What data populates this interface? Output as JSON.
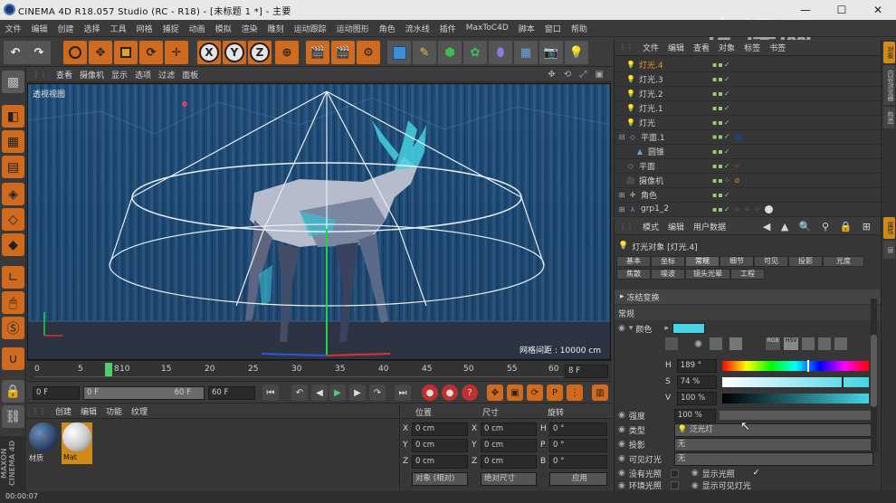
{
  "window": {
    "title": "CINEMA 4D R18.057 Studio (RC - R18) - [未标题 1 *] - 主要",
    "minimize": "—",
    "maximize": "☐",
    "close": "✕"
  },
  "watermark": "虎课网",
  "menu": [
    "文件",
    "编辑",
    "创建",
    "选择",
    "工具",
    "网格",
    "捕捉",
    "动画",
    "模拟",
    "渲染",
    "雕刻",
    "运动跟踪",
    "运动图形",
    "角色",
    "流水线",
    "插件",
    "MaxToC4D",
    "脚本",
    "窗口",
    "帮助"
  ],
  "toolbar": {
    "x": "X",
    "y": "Y",
    "z": "Z"
  },
  "viewport": {
    "menu": [
      "查看",
      "摄像机",
      "显示",
      "选项",
      "过滤",
      "面板"
    ],
    "label": "透视视图",
    "grid_text": "网格间距 : 10000 cm"
  },
  "timeline": {
    "ticks": [
      "0",
      "5",
      "10",
      "15",
      "20",
      "25",
      "30",
      "35",
      "40",
      "45",
      "50",
      "55",
      "60"
    ],
    "current_frame_marker": "8",
    "end_field": "8 F"
  },
  "transport": {
    "start": "0 F",
    "range_start": "0 F",
    "range_end": "60 F",
    "end": "60 F"
  },
  "materials": {
    "menu": [
      "创建",
      "编辑",
      "功能",
      "纹理"
    ],
    "items": [
      "材质",
      "Mat"
    ]
  },
  "coords": {
    "headers": {
      "position": "位置",
      "size": "尺寸",
      "rotation": "旋转"
    },
    "rows": [
      {
        "p_label": "X",
        "p": "0 cm",
        "s_label": "X",
        "s": "0 cm",
        "r_label": "H",
        "r": "0 °"
      },
      {
        "p_label": "Y",
        "p": "0 cm",
        "s_label": "Y",
        "s": "0 cm",
        "r_label": "P",
        "r": "0 °"
      },
      {
        "p_label": "Z",
        "p": "0 cm",
        "s_label": "Z",
        "s": "0 cm",
        "r_label": "B",
        "r": "0 °"
      }
    ],
    "mode": "对象 (相对)",
    "size_mode": "绝对尺寸",
    "apply": "应用"
  },
  "objects": {
    "menu": [
      "文件",
      "编辑",
      "查看",
      "对象",
      "标签",
      "书签"
    ],
    "items": [
      {
        "name": "灯光.4",
        "icon": "light-icon",
        "active": true
      },
      {
        "name": "灯光.3",
        "icon": "light-icon"
      },
      {
        "name": "灯光.2",
        "icon": "light-icon"
      },
      {
        "name": "灯光.1",
        "icon": "light-icon"
      },
      {
        "name": "灯光",
        "icon": "light-icon"
      },
      {
        "name": "平面.1",
        "icon": "plane-icon"
      },
      {
        "name": "圆锥",
        "icon": "cone-icon"
      },
      {
        "name": "平面",
        "icon": "plane-icon"
      },
      {
        "name": "摄像机",
        "icon": "camera-icon"
      },
      {
        "name": "角色",
        "icon": "null-icon"
      },
      {
        "name": "grp1_2",
        "icon": "null-icon"
      }
    ]
  },
  "attributes": {
    "menu": [
      "模式",
      "编辑",
      "用户数据"
    ],
    "object_title": "灯光对象 [灯光.4]",
    "tabs_row1": [
      "基本",
      "坐标",
      "常规",
      "细节",
      "可见",
      "投影",
      "光度"
    ],
    "tabs_row2": [
      "焦散",
      "噪波",
      "镜头光晕",
      "工程"
    ],
    "section_transform": "冻结变换",
    "section_general": "常规",
    "color_label": "颜色",
    "h_label": "H",
    "h_value": "189 °",
    "s_label": "S",
    "s_value": "74 %",
    "v_label": "V",
    "v_value": "100 %",
    "intensity_label": "强度",
    "intensity_value": "100 %",
    "type_label": "类型",
    "type_value": "泛光灯",
    "shadow_label": "投影",
    "shadow_value": "无",
    "visible_label": "可见灯光",
    "visible_value": "无",
    "no_light_label": "没有光照",
    "show_light_label": "显示光照",
    "ambient_label": "环境光照",
    "show_visible_label": "显示可见灯光",
    "swatch_color": "#44d4e2"
  },
  "right_tabs": [
    "对象",
    "内容浏览器",
    "构造",
    "属性",
    "层"
  ],
  "status": {
    "time": "00:00:07"
  }
}
